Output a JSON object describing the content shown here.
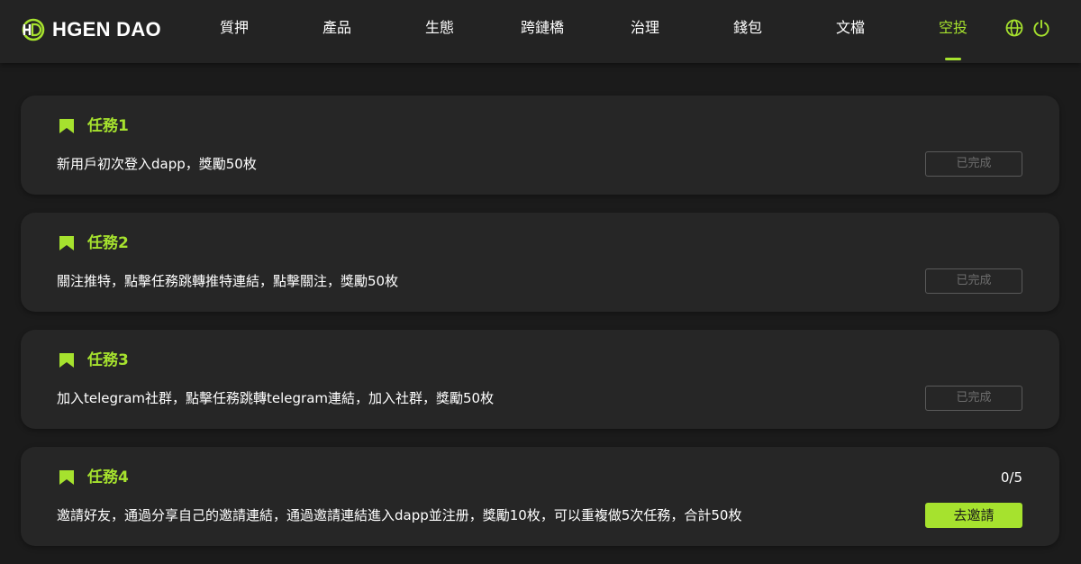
{
  "brand": {
    "name": "HGEN DAO",
    "accent_color": "#a6e22e"
  },
  "nav": {
    "items": [
      {
        "label": "質押"
      },
      {
        "label": "產品"
      },
      {
        "label": "生態"
      },
      {
        "label": "跨鏈橋"
      },
      {
        "label": "治理"
      },
      {
        "label": "錢包"
      },
      {
        "label": "文檔"
      },
      {
        "label": "空投",
        "active": true
      }
    ],
    "icons": [
      "globe-icon",
      "power-icon"
    ]
  },
  "tasks": [
    {
      "title": "任務1",
      "description": "新用戶初次登入dapp，獎勵50枚",
      "button": "已完成",
      "status": "completed"
    },
    {
      "title": "任務2",
      "description": "關注推特，點擊任務跳轉推特連結，點擊關注，獎勵50枚",
      "button": "已完成",
      "status": "completed"
    },
    {
      "title": "任務3",
      "description": "加入telegram社群，點擊任務跳轉telegram連結，加入社群，獎勵50枚",
      "button": "已完成",
      "status": "completed"
    },
    {
      "title": "任務4",
      "description": "邀請好友，通過分享自己的邀請連結，通過邀請連結進入dapp並注册，獎勵10枚，可以重複做5次任務，合計50枚",
      "button": "去邀請",
      "status": "active",
      "progress": "0/5"
    }
  ]
}
